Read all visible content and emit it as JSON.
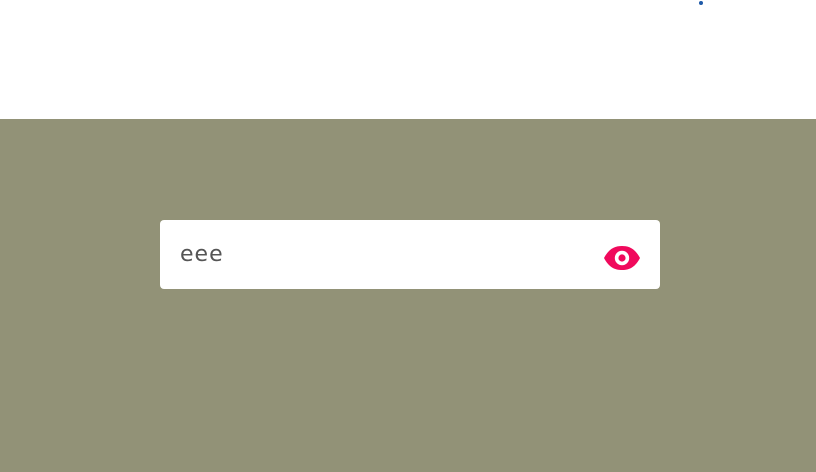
{
  "colors": {
    "page_background": "#929277",
    "top_background": "#ffffff",
    "field_background": "#ffffff",
    "field_text": "#555555",
    "accent": "#f0095c",
    "dot": "#1f5aa8"
  },
  "password_field": {
    "value": "eee",
    "type": "text"
  },
  "visibility_toggle": {
    "icon": "eye-icon",
    "state": "visible"
  }
}
